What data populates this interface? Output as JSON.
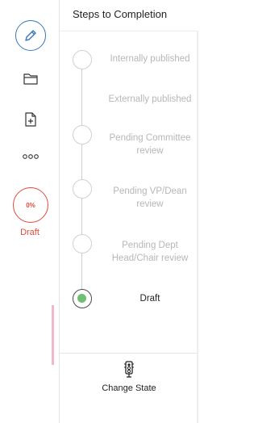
{
  "panel": {
    "title": "Steps to Completion"
  },
  "rail": {
    "percent": "0%",
    "status": "Draft"
  },
  "steps": [
    {
      "label": "Internally published",
      "state": "pending"
    },
    {
      "label": "Externally published",
      "state": "pending"
    },
    {
      "label": "Pending Committee review",
      "state": "pending"
    },
    {
      "label": "Pending VP/Dean review",
      "state": "pending"
    },
    {
      "label": "Pending Dept Head/Chair review",
      "state": "pending"
    },
    {
      "label": "Draft",
      "state": "current"
    }
  ],
  "footer": {
    "change_state_label": "Change State"
  },
  "colors": {
    "accent_blue": "#3a76b8",
    "status_red": "#e04a3c",
    "current_green": "#6fbf73",
    "muted_text": "#b7b7b7"
  },
  "icons": [
    "edit-pencil-icon",
    "folder-icon",
    "add-document-icon",
    "more-dots-icon",
    "traffic-light-icon"
  ]
}
